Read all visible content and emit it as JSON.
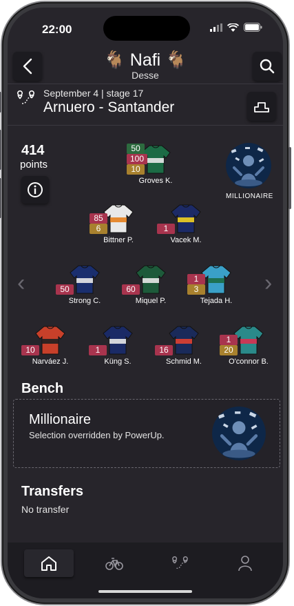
{
  "status": {
    "time": "22:00"
  },
  "header": {
    "title": "🐐 Nafi 🐐",
    "subtitle": "Desse"
  },
  "stage": {
    "date": "September 4 | stage 17",
    "route": "Arnuero - Santander"
  },
  "score": {
    "points": "414",
    "label": "points"
  },
  "powerup": {
    "label": "MILLIONAIRE"
  },
  "colors": {
    "red": "#a8344e",
    "gold": "#a8812e",
    "green": "#2d6b3f",
    "background": "#27252b"
  },
  "riders": [
    {
      "name": "Groves K.",
      "badges": [
        {
          "v": "50",
          "c": "green"
        },
        {
          "v": "100",
          "c": "red"
        },
        {
          "v": "10",
          "c": "gold"
        }
      ]
    },
    {
      "name": "Bittner P.",
      "badges": [
        {
          "v": "85",
          "c": "red"
        },
        {
          "v": "6",
          "c": "gold"
        }
      ]
    },
    {
      "name": "Vacek M.",
      "badges": [
        {
          "v": "1",
          "c": "red"
        }
      ]
    },
    {
      "name": "Strong C.",
      "badges": [
        {
          "v": "50",
          "c": "red"
        }
      ]
    },
    {
      "name": "Miquel P.",
      "badges": [
        {
          "v": "60",
          "c": "red"
        }
      ]
    },
    {
      "name": "Tejada H.",
      "badges": [
        {
          "v": "1",
          "c": "red"
        },
        {
          "v": "3",
          "c": "gold"
        }
      ]
    },
    {
      "name": "Narváez J.",
      "badges": [
        {
          "v": "10",
          "c": "red"
        }
      ]
    },
    {
      "name": "Küng S.",
      "badges": [
        {
          "v": "1",
          "c": "red"
        }
      ]
    },
    {
      "name": "Schmid M.",
      "badges": [
        {
          "v": "16",
          "c": "red"
        }
      ]
    },
    {
      "name": "O'connor B.",
      "badges": [
        {
          "v": "1",
          "c": "red"
        },
        {
          "v": "20",
          "c": "gold"
        }
      ]
    }
  ],
  "bench": {
    "title": "Bench",
    "name": "Millionaire",
    "description": "Selection overridden by PowerUp."
  },
  "transfers": {
    "title": "Transfers",
    "description": "No transfer"
  },
  "tabs": [
    {
      "icon": "home-icon",
      "active": true
    },
    {
      "icon": "bicycle-icon",
      "active": false
    },
    {
      "icon": "route-icon",
      "active": false
    },
    {
      "icon": "profile-icon",
      "active": false
    }
  ]
}
